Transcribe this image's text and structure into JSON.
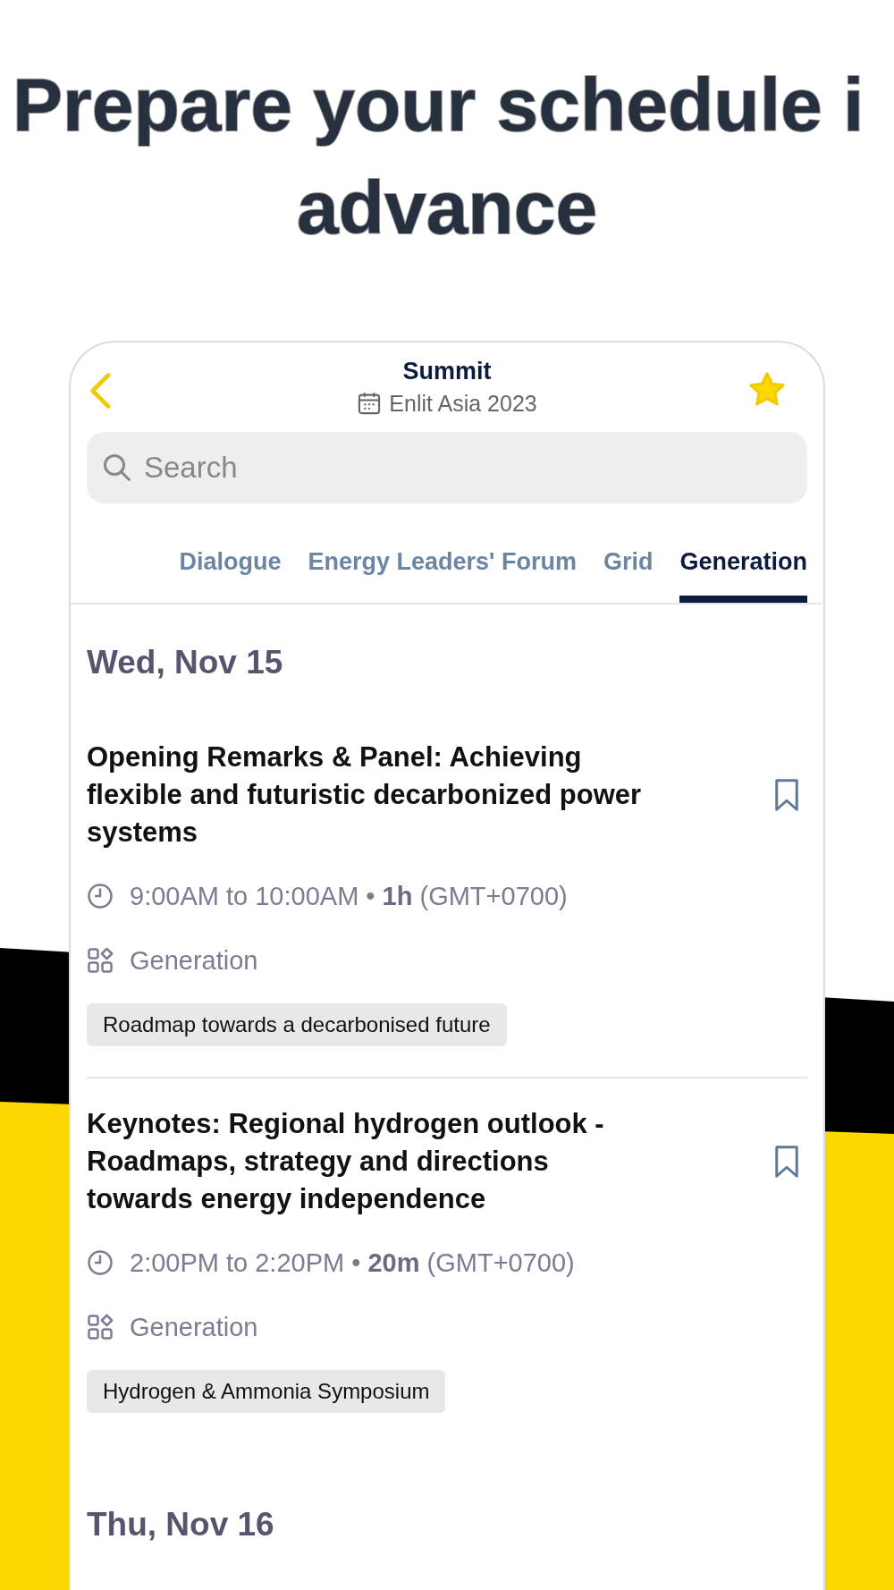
{
  "headline": {
    "lines": [
      "Prepare your schedule i",
      "advance"
    ]
  },
  "header": {
    "title": "Summit",
    "subtitle": "Enlit Asia 2023",
    "favorite": true
  },
  "search": {
    "placeholder": "Search"
  },
  "tabs": [
    {
      "label": "Dialogue",
      "selected": false
    },
    {
      "label": "Energy Leaders' Forum",
      "selected": false
    },
    {
      "label": "Grid",
      "selected": false
    },
    {
      "label": "Generation",
      "selected": true
    }
  ],
  "days": [
    {
      "date": "Wed, Nov 15",
      "sessions": [
        {
          "title": "Opening Remarks & Panel:  Achieving flexible and futuristic decarbonized power systems",
          "time": "9:00AM to 10:00AM • **1h** (GMT+0700)",
          "category": "Generation",
          "tag": "Roadmap towards a decarbonised future",
          "bookmarked": false
        },
        {
          "title": "Keynotes: Regional hydrogen outlook - Roadmaps, strategy and directions towards energy independence",
          "time": "2:00PM to 2:20PM • **20m** (GMT+0700)",
          "category": "Generation",
          "tag": "Hydrogen & Ammonia Symposium",
          "bookmarked": false
        }
      ]
    },
    {
      "date": "Thu, Nov 16"
    }
  ]
}
